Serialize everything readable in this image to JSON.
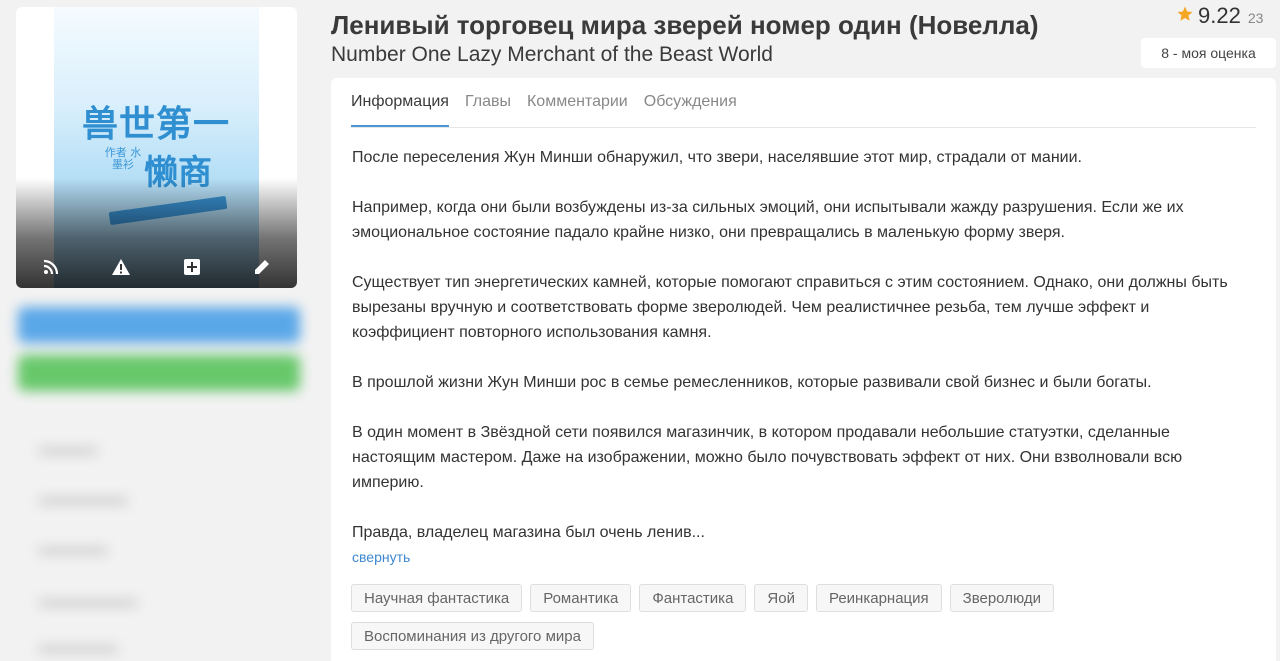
{
  "cover": {
    "title_line1": "兽世第一",
    "title_line2": "懒商",
    "author": "作者 水墨衫",
    "actions": [
      "rss-icon",
      "warning-icon",
      "plus-icon",
      "pencil-icon"
    ]
  },
  "header": {
    "title_ru": "Ленивый торговец мира зверей номер один (Новелла)",
    "title_en": "Number One Lazy Merchant of the Beast World"
  },
  "rating": {
    "score": "9.22",
    "count": "23",
    "my_rating": "8 - моя оценка",
    "star_color": "#f5a623"
  },
  "tabs": [
    {
      "label": "Информация",
      "active": true
    },
    {
      "label": "Главы",
      "active": false
    },
    {
      "label": "Комментарии",
      "active": false
    },
    {
      "label": "Обсуждения",
      "active": false
    }
  ],
  "description": [
    "После переселения Жун Минши обнаружил, что звери, населявшие этот мир, страдали от мании.",
    "Например, когда они были возбуждены из-за сильных эмоций, они испытывали жажду разрушения. Если же их эмоциональное состояние падало крайне низко, они превращались в маленькую форму зверя.",
    "Существует тип энергетических камней, которые помогают справиться с этим состоянием. Однако, они должны быть вырезаны вручную и соответствовать форме зверолюдей. Чем реалистичнее резьба, тем лучше эффект и коэффициент повторного использования камня.",
    "В прошлой жизни Жун Минши рос в семье ремесленников, которые развивали свой бизнес и были богаты.",
    "В один момент в Звёздной сети появился магазинчик, в котором продавали небольшие статуэтки, сделанные настоящим мастером. Даже на изображении, можно было почувствовать эффект от них. Они взволновали всю империю.",
    "Правда, владелец магазина был очень ленив..."
  ],
  "collapse_label": "свернуть",
  "tags": [
    "Научная фантастика",
    "Романтика",
    "Фантастика",
    "Яой",
    "Реинкарнация",
    "Зверолюди",
    "Воспоминания из другого мира"
  ],
  "colors": {
    "accent": "#4a95d8",
    "link": "#3d88d0",
    "sidebar_blue": "#5aa7e8",
    "sidebar_green": "#67c86a"
  }
}
